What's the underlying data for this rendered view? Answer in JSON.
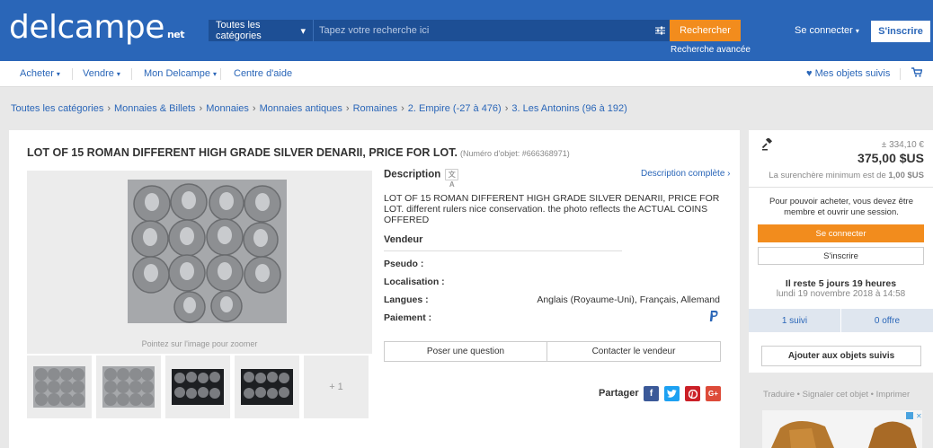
{
  "header": {
    "logo": "delcampe",
    "logo_suffix": "net",
    "category_select": "Toutes les catégories",
    "search_placeholder": "Tapez votre recherche ici",
    "search_button": "Rechercher",
    "advanced_search": "Recherche avancée",
    "connect": "Se connecter",
    "signup": "S'inscrire"
  },
  "nav": {
    "buy": "Acheter",
    "sell": "Vendre",
    "my_delcampe": "Mon Delcampe",
    "help": "Centre d'aide",
    "watched": "Mes objets suivis"
  },
  "breadcrumb": [
    "Toutes les catégories",
    "Monnaies & Billets",
    "Monnaies",
    "Monnaies antiques",
    "Romaines",
    "2. Empire (-27 à 476)",
    "3. Les Antonins (96 à 192)"
  ],
  "item": {
    "title": "LOT OF 15 ROMAN DIFFERENT HIGH GRADE SILVER DENARII, PRICE FOR LOT.",
    "number": "(Numéro d'objet: #666368971)",
    "zoom_hint": "Pointez sur l'image pour zoomer",
    "more_photos": "+ 1",
    "description_title": "Description",
    "description_full": "Description complète ›",
    "description_text": "LOT OF 15 ROMAN DIFFERENT HIGH GRADE SILVER DENARII, PRICE FOR LOT. different rulers nice conservation. the photo reflects the ACTUAL COINS OFFERED",
    "seller_title": "Vendeur",
    "fields": {
      "pseudo_label": "Pseudo :",
      "location_label": "Localisation :",
      "languages_label": "Langues :",
      "languages_value": "Anglais (Royaume-Uni), Français, Allemand",
      "payment_label": "Paiement :"
    },
    "ask_question": "Poser une question",
    "contact_seller": "Contacter le vendeur",
    "share": "Partager"
  },
  "sidebar": {
    "estimated": "± 334,10 €",
    "price": "375,00 $US",
    "min_bid_prefix": "La surenchère minimum est de ",
    "min_bid_value": "1,00 $US",
    "must_member": "Pour pouvoir acheter, vous devez être membre et ouvrir une session.",
    "login": "Se connecter",
    "signup": "S'inscrire",
    "time_left": "Il reste 5 jours 19 heures",
    "end_date": "lundi 19 novembre 2018 à 14:58",
    "followers": "1 suivi",
    "offers": "0 offre",
    "add_watch": "Ajouter aux objets suivis",
    "links": "Traduire • Signaler cet objet • Imprimer"
  },
  "colors": {
    "brand_blue": "#2a66b8",
    "accent_orange": "#f28c1d"
  }
}
